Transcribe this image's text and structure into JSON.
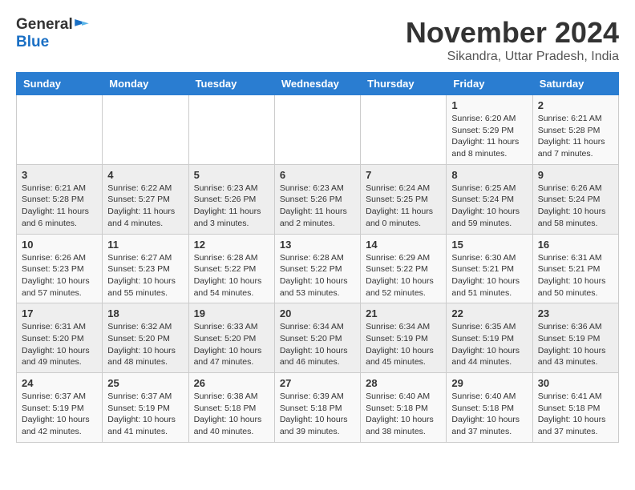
{
  "logo": {
    "general": "General",
    "blue": "Blue"
  },
  "title": {
    "month": "November 2024",
    "location": "Sikandra, Uttar Pradesh, India"
  },
  "headers": [
    "Sunday",
    "Monday",
    "Tuesday",
    "Wednesday",
    "Thursday",
    "Friday",
    "Saturday"
  ],
  "weeks": [
    [
      {
        "day": "",
        "info": ""
      },
      {
        "day": "",
        "info": ""
      },
      {
        "day": "",
        "info": ""
      },
      {
        "day": "",
        "info": ""
      },
      {
        "day": "",
        "info": ""
      },
      {
        "day": "1",
        "info": "Sunrise: 6:20 AM\nSunset: 5:29 PM\nDaylight: 11 hours and 8 minutes."
      },
      {
        "day": "2",
        "info": "Sunrise: 6:21 AM\nSunset: 5:28 PM\nDaylight: 11 hours and 7 minutes."
      }
    ],
    [
      {
        "day": "3",
        "info": "Sunrise: 6:21 AM\nSunset: 5:28 PM\nDaylight: 11 hours and 6 minutes."
      },
      {
        "day": "4",
        "info": "Sunrise: 6:22 AM\nSunset: 5:27 PM\nDaylight: 11 hours and 4 minutes."
      },
      {
        "day": "5",
        "info": "Sunrise: 6:23 AM\nSunset: 5:26 PM\nDaylight: 11 hours and 3 minutes."
      },
      {
        "day": "6",
        "info": "Sunrise: 6:23 AM\nSunset: 5:26 PM\nDaylight: 11 hours and 2 minutes."
      },
      {
        "day": "7",
        "info": "Sunrise: 6:24 AM\nSunset: 5:25 PM\nDaylight: 11 hours and 0 minutes."
      },
      {
        "day": "8",
        "info": "Sunrise: 6:25 AM\nSunset: 5:24 PM\nDaylight: 10 hours and 59 minutes."
      },
      {
        "day": "9",
        "info": "Sunrise: 6:26 AM\nSunset: 5:24 PM\nDaylight: 10 hours and 58 minutes."
      }
    ],
    [
      {
        "day": "10",
        "info": "Sunrise: 6:26 AM\nSunset: 5:23 PM\nDaylight: 10 hours and 57 minutes."
      },
      {
        "day": "11",
        "info": "Sunrise: 6:27 AM\nSunset: 5:23 PM\nDaylight: 10 hours and 55 minutes."
      },
      {
        "day": "12",
        "info": "Sunrise: 6:28 AM\nSunset: 5:22 PM\nDaylight: 10 hours and 54 minutes."
      },
      {
        "day": "13",
        "info": "Sunrise: 6:28 AM\nSunset: 5:22 PM\nDaylight: 10 hours and 53 minutes."
      },
      {
        "day": "14",
        "info": "Sunrise: 6:29 AM\nSunset: 5:22 PM\nDaylight: 10 hours and 52 minutes."
      },
      {
        "day": "15",
        "info": "Sunrise: 6:30 AM\nSunset: 5:21 PM\nDaylight: 10 hours and 51 minutes."
      },
      {
        "day": "16",
        "info": "Sunrise: 6:31 AM\nSunset: 5:21 PM\nDaylight: 10 hours and 50 minutes."
      }
    ],
    [
      {
        "day": "17",
        "info": "Sunrise: 6:31 AM\nSunset: 5:20 PM\nDaylight: 10 hours and 49 minutes."
      },
      {
        "day": "18",
        "info": "Sunrise: 6:32 AM\nSunset: 5:20 PM\nDaylight: 10 hours and 48 minutes."
      },
      {
        "day": "19",
        "info": "Sunrise: 6:33 AM\nSunset: 5:20 PM\nDaylight: 10 hours and 47 minutes."
      },
      {
        "day": "20",
        "info": "Sunrise: 6:34 AM\nSunset: 5:20 PM\nDaylight: 10 hours and 46 minutes."
      },
      {
        "day": "21",
        "info": "Sunrise: 6:34 AM\nSunset: 5:19 PM\nDaylight: 10 hours and 45 minutes."
      },
      {
        "day": "22",
        "info": "Sunrise: 6:35 AM\nSunset: 5:19 PM\nDaylight: 10 hours and 44 minutes."
      },
      {
        "day": "23",
        "info": "Sunrise: 6:36 AM\nSunset: 5:19 PM\nDaylight: 10 hours and 43 minutes."
      }
    ],
    [
      {
        "day": "24",
        "info": "Sunrise: 6:37 AM\nSunset: 5:19 PM\nDaylight: 10 hours and 42 minutes."
      },
      {
        "day": "25",
        "info": "Sunrise: 6:37 AM\nSunset: 5:19 PM\nDaylight: 10 hours and 41 minutes."
      },
      {
        "day": "26",
        "info": "Sunrise: 6:38 AM\nSunset: 5:18 PM\nDaylight: 10 hours and 40 minutes."
      },
      {
        "day": "27",
        "info": "Sunrise: 6:39 AM\nSunset: 5:18 PM\nDaylight: 10 hours and 39 minutes."
      },
      {
        "day": "28",
        "info": "Sunrise: 6:40 AM\nSunset: 5:18 PM\nDaylight: 10 hours and 38 minutes."
      },
      {
        "day": "29",
        "info": "Sunrise: 6:40 AM\nSunset: 5:18 PM\nDaylight: 10 hours and 37 minutes."
      },
      {
        "day": "30",
        "info": "Sunrise: 6:41 AM\nSunset: 5:18 PM\nDaylight: 10 hours and 37 minutes."
      }
    ]
  ]
}
